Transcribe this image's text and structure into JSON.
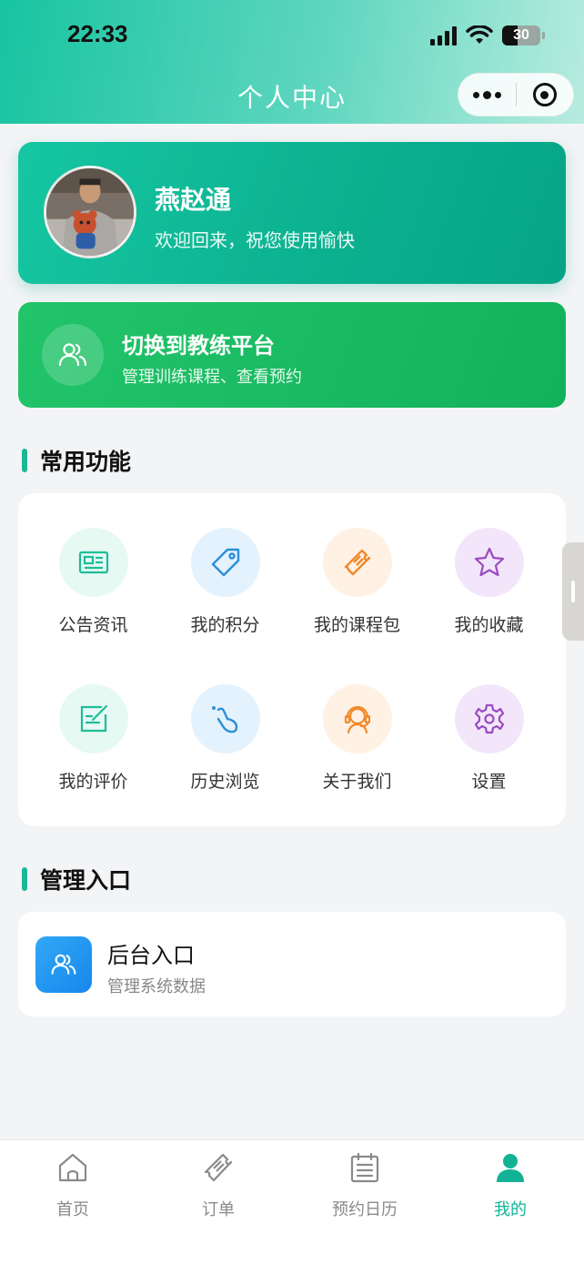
{
  "status_bar": {
    "time": "22:33",
    "battery": "30"
  },
  "nav": {
    "title": "个人中心"
  },
  "profile": {
    "name": "燕赵通",
    "greeting": "欢迎回来，祝您使用愉快"
  },
  "switch_platform": {
    "title": "切换到教练平台",
    "subtitle": "管理训练课程、查看预约",
    "icon": "users-icon"
  },
  "common_section": {
    "title": "常用功能",
    "items": [
      {
        "label": "公告资讯",
        "icon": "newspaper-icon",
        "bg": "#e6f9f3",
        "color": "#1dbd98"
      },
      {
        "label": "我的积分",
        "icon": "tag-icon",
        "bg": "#e4f2fd",
        "color": "#2a8fd8"
      },
      {
        "label": "我的课程包",
        "icon": "ticket-icon",
        "bg": "#fff1e4",
        "color": "#f08a2c"
      },
      {
        "label": "我的收藏",
        "icon": "star-icon",
        "bg": "#f3e6fa",
        "color": "#9b4bc1"
      },
      {
        "label": "我的评价",
        "icon": "edit-icon",
        "bg": "#e6f9f3",
        "color": "#1dbd98"
      },
      {
        "label": "历史浏览",
        "icon": "footprint-icon",
        "bg": "#e4f2fd",
        "color": "#2a8fd8"
      },
      {
        "label": "关于我们",
        "icon": "headset-icon",
        "bg": "#fff1e4",
        "color": "#f08a2c"
      },
      {
        "label": "设置",
        "icon": "gear-icon",
        "bg": "#f3e6fa",
        "color": "#9b4bc1"
      }
    ]
  },
  "admin_section": {
    "title": "管理入口",
    "card_title": "后台入口",
    "card_subtitle": "管理系统数据",
    "icon": "users-icon"
  },
  "tabbar": {
    "items": [
      {
        "label": "首页",
        "icon": "home-icon",
        "active": false
      },
      {
        "label": "订单",
        "icon": "ticket-icon",
        "active": false
      },
      {
        "label": "预约日历",
        "icon": "calendar-icon",
        "active": false
      },
      {
        "label": "我的",
        "icon": "person-icon",
        "active": true
      }
    ]
  },
  "colors": {
    "brand": "#17c4a1",
    "switch_card": "#1bbd62",
    "admin_icon": "#2297ef",
    "tab_active": "#12b394"
  }
}
